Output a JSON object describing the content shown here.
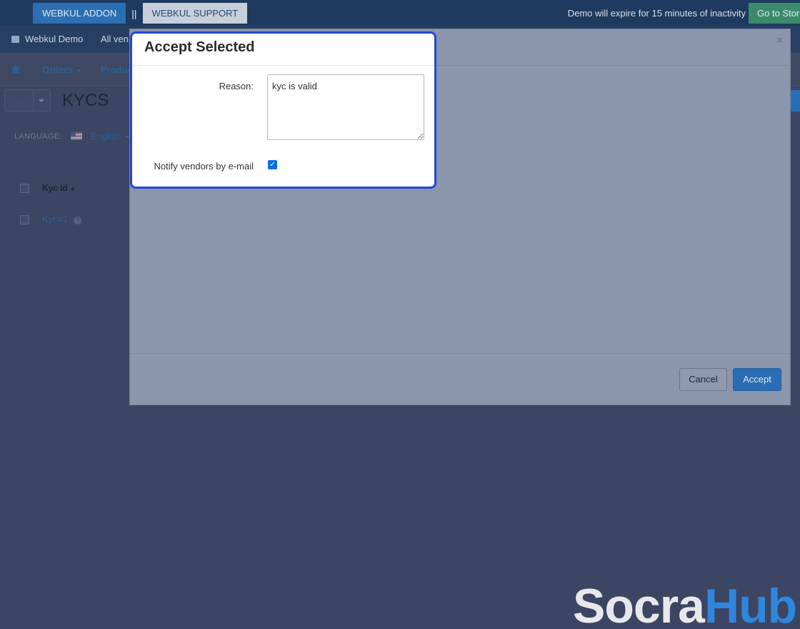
{
  "top_bar": {
    "addon_tab": "WEBKUL ADDON",
    "separator": "||",
    "support_tab": "WEBKUL SUPPORT",
    "demo_notice": "Demo will expire for 15 minutes of inactivity",
    "goto_store": "Go to Store"
  },
  "nav_bar": {
    "store_name": "Webkul Demo",
    "vendor_selector": "All ven"
  },
  "menu": {
    "items": [
      "Orders",
      "Produc"
    ]
  },
  "page": {
    "title": "KYCS",
    "language_label": "LANGUAGE:",
    "language_value": "English",
    "table": {
      "column_kyc_id": "Kyc Id",
      "rows": [
        "Kyc#1"
      ]
    }
  },
  "modal": {
    "title": "Accept Selected",
    "close_symbol": "×",
    "reason_label": "Reason:",
    "reason_value": "kyc is valid",
    "notify_label": "Notify vendors by e-mail",
    "notify_checked": true,
    "cancel_label": "Cancel",
    "accept_label": "Accept"
  },
  "watermark": {
    "part1": "Socra",
    "part2": "Hub"
  },
  "colors": {
    "accent": "#2346d6",
    "primary_button": "#2b6db5",
    "checkbox": "#0b6fe0"
  }
}
